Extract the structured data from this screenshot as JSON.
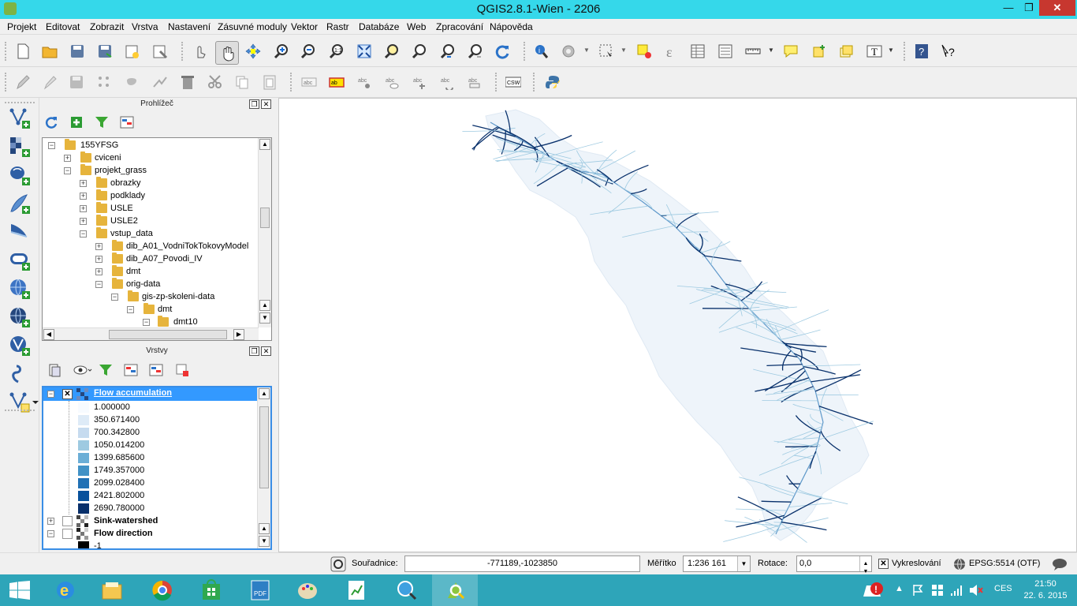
{
  "window": {
    "title": "QGIS2.8.1-Wien - 2206",
    "min": "—",
    "max": "❐",
    "close": "✕"
  },
  "menu": [
    "Projekt",
    "Editovat",
    "Zobrazit",
    "Vrstva",
    "Nastavení",
    "Zásuvné moduly",
    "Vektor",
    "Rastr",
    "Databáze",
    "Web",
    "Zpracování",
    "Nápověda"
  ],
  "browser": {
    "title": "Prohlížeč",
    "items": [
      {
        "label": "155YFSG",
        "expander": "−"
      },
      {
        "label": "cviceni",
        "expander": "+"
      },
      {
        "label": "projekt_grass",
        "expander": "−"
      },
      {
        "label": "obrazky",
        "expander": "+"
      },
      {
        "label": "podklady",
        "expander": "+"
      },
      {
        "label": "USLE",
        "expander": "+"
      },
      {
        "label": "USLE2",
        "expander": "+"
      },
      {
        "label": "vstup_data",
        "expander": "−"
      },
      {
        "label": "dib_A01_VodniTokTokovyModel",
        "expander": "+"
      },
      {
        "label": "dib_A07_Povodi_IV",
        "expander": "+"
      },
      {
        "label": "dmt",
        "expander": "+"
      },
      {
        "label": "orig-data",
        "expander": "−"
      },
      {
        "label": "gis-zp-skoleni-data",
        "expander": "−"
      },
      {
        "label": "dmt",
        "expander": "−"
      },
      {
        "label": "dmt10",
        "expander": "−"
      }
    ]
  },
  "layers": {
    "title": "Vrstvy",
    "flow_accumulation": {
      "name": "Flow accumulation",
      "checked": "✕",
      "expander": "−"
    },
    "legend": [
      {
        "value": "1.000000",
        "color": "#f7fbff"
      },
      {
        "value": "350.671400",
        "color": "#deebf7"
      },
      {
        "value": "700.342800",
        "color": "#c6dbef"
      },
      {
        "value": "1050.014200",
        "color": "#9ecae1"
      },
      {
        "value": "1399.685600",
        "color": "#6baed6"
      },
      {
        "value": "1749.357000",
        "color": "#4292c6"
      },
      {
        "value": "2099.028400",
        "color": "#2171b5"
      },
      {
        "value": "2421.802000",
        "color": "#08519c"
      },
      {
        "value": "2690.780000",
        "color": "#08306b"
      }
    ],
    "sink_watershed": {
      "name": "Sink-watershed",
      "expander": "+"
    },
    "flow_direction": {
      "name": "Flow direction",
      "expander": "−",
      "first_class": "-1"
    }
  },
  "status": {
    "coord_label": "Souřadnice:",
    "coord_value": "-771189,-1023850",
    "scale_label": "Měřítko",
    "scale_value": "1:236 161",
    "rotation_label": "Rotace:",
    "rotation_value": "0,0",
    "render_label": "Vykreslování",
    "render_checked": "✕",
    "crs": "EPSG:5514 (OTF)"
  },
  "taskbar": {
    "lang": "CES",
    "time": "21:50",
    "date": "22. 6. 2015"
  },
  "colors": {
    "titlebar": "#35d8ea",
    "taskbar": "#2ea5b9",
    "selection": "#3399ff",
    "map_stream": "#08306b",
    "map_fill": "#eef4fa"
  }
}
